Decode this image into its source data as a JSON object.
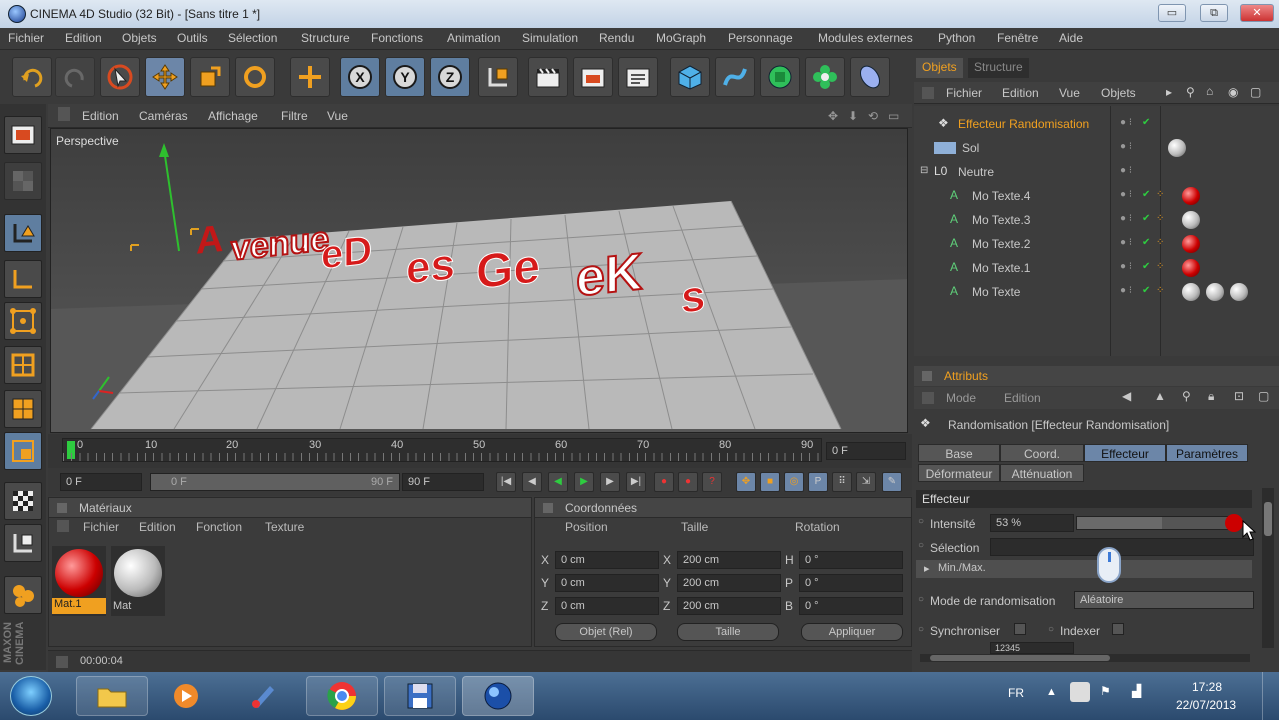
{
  "window": {
    "title": "CINEMA 4D Studio (32 Bit) - [Sans titre 1 *]",
    "buttons": [
      "▭",
      "⧉",
      "✕"
    ]
  },
  "menubar": [
    "Fichier",
    "Edition",
    "Objets",
    "Outils",
    "Sélection",
    "Structure",
    "Fonctions",
    "Animation",
    "Simulation",
    "Rendu",
    "MoGraph",
    "Personnage",
    "Modules externes",
    "Python",
    "Fenêtre",
    "Aide"
  ],
  "toolbar": {
    "axes": [
      "X",
      "Y",
      "Z"
    ]
  },
  "viewport": {
    "menu": [
      "Edition",
      "Caméras",
      "Affichage",
      "Filtre",
      "Vue"
    ],
    "label": "Perspective"
  },
  "timeline": {
    "ticks": [
      "0",
      "10",
      "20",
      "30",
      "40",
      "50",
      "60",
      "70",
      "80",
      "90"
    ],
    "current_frame": "0 F",
    "start": "0 F",
    "range_start": "0 F",
    "range_end": "90 F",
    "end": "90 F"
  },
  "materials": {
    "title": "Matériaux",
    "menu": [
      "Fichier",
      "Edition",
      "Fonction",
      "Texture"
    ],
    "items": [
      {
        "name": "Mat.1",
        "color": "red",
        "selected": true
      },
      {
        "name": "Mat",
        "color": "white",
        "selected": false
      }
    ]
  },
  "coordinates": {
    "title": "Coordonnées",
    "headers": [
      "Position",
      "Taille",
      "Rotation"
    ],
    "rows": [
      {
        "axis": "X",
        "pos": "0 cm",
        "size_axis": "X",
        "size": "200 cm",
        "rot_axis": "H",
        "rot": "0 °"
      },
      {
        "axis": "Y",
        "pos": "0 cm",
        "size_axis": "Y",
        "size": "200 cm",
        "rot_axis": "P",
        "rot": "0 °"
      },
      {
        "axis": "Z",
        "pos": "0 cm",
        "size_axis": "Z",
        "size": "200 cm",
        "rot_axis": "B",
        "rot": "0 °"
      }
    ],
    "mode": "Objet (Rel)",
    "size_mode": "Taille",
    "apply": "Appliquer"
  },
  "status": {
    "time": "00:00:04"
  },
  "objects_panel": {
    "tabs": [
      "Objets",
      "Structure"
    ],
    "menu": [
      "Fichier",
      "Edition",
      "Vue",
      "Objets"
    ],
    "items": [
      {
        "name": "Effecteur Randomisation",
        "highlight": true,
        "indent": 0
      },
      {
        "name": "Sol",
        "highlight": false,
        "indent": 0
      },
      {
        "name": "Neutre",
        "highlight": false,
        "indent": 0
      },
      {
        "name": "Mo Texte.4",
        "highlight": false,
        "indent": 1
      },
      {
        "name": "Mo Texte.3",
        "highlight": false,
        "indent": 1
      },
      {
        "name": "Mo Texte.2",
        "highlight": false,
        "indent": 1
      },
      {
        "name": "Mo Texte.1",
        "highlight": false,
        "indent": 1
      },
      {
        "name": "Mo Texte",
        "highlight": false,
        "indent": 1
      }
    ]
  },
  "attributes_panel": {
    "title": "Attributs",
    "menu": [
      "Mode",
      "Edition"
    ],
    "object_label": "Randomisation [Effecteur Randomisation]",
    "tabs_row1": [
      "Base",
      "Coord.",
      "Effecteur",
      "Paramètres"
    ],
    "tabs_row2": [
      "Déformateur",
      "Atténuation"
    ],
    "section": "Effecteur",
    "intensity_label": "Intensité",
    "intensity_value": "53 %",
    "intensity_fraction": 0.53,
    "selection_label": "Sélection",
    "minmax_label": "Min./Max.",
    "random_mode_label": "Mode de randomisation",
    "random_mode_value": "Aléatoire",
    "sync_label": "Synchroniser",
    "index_label": "Indexer",
    "seed_value": "12345"
  },
  "taskbar": {
    "lang": "FR",
    "time": "17:28",
    "date": "22/07/2013"
  }
}
